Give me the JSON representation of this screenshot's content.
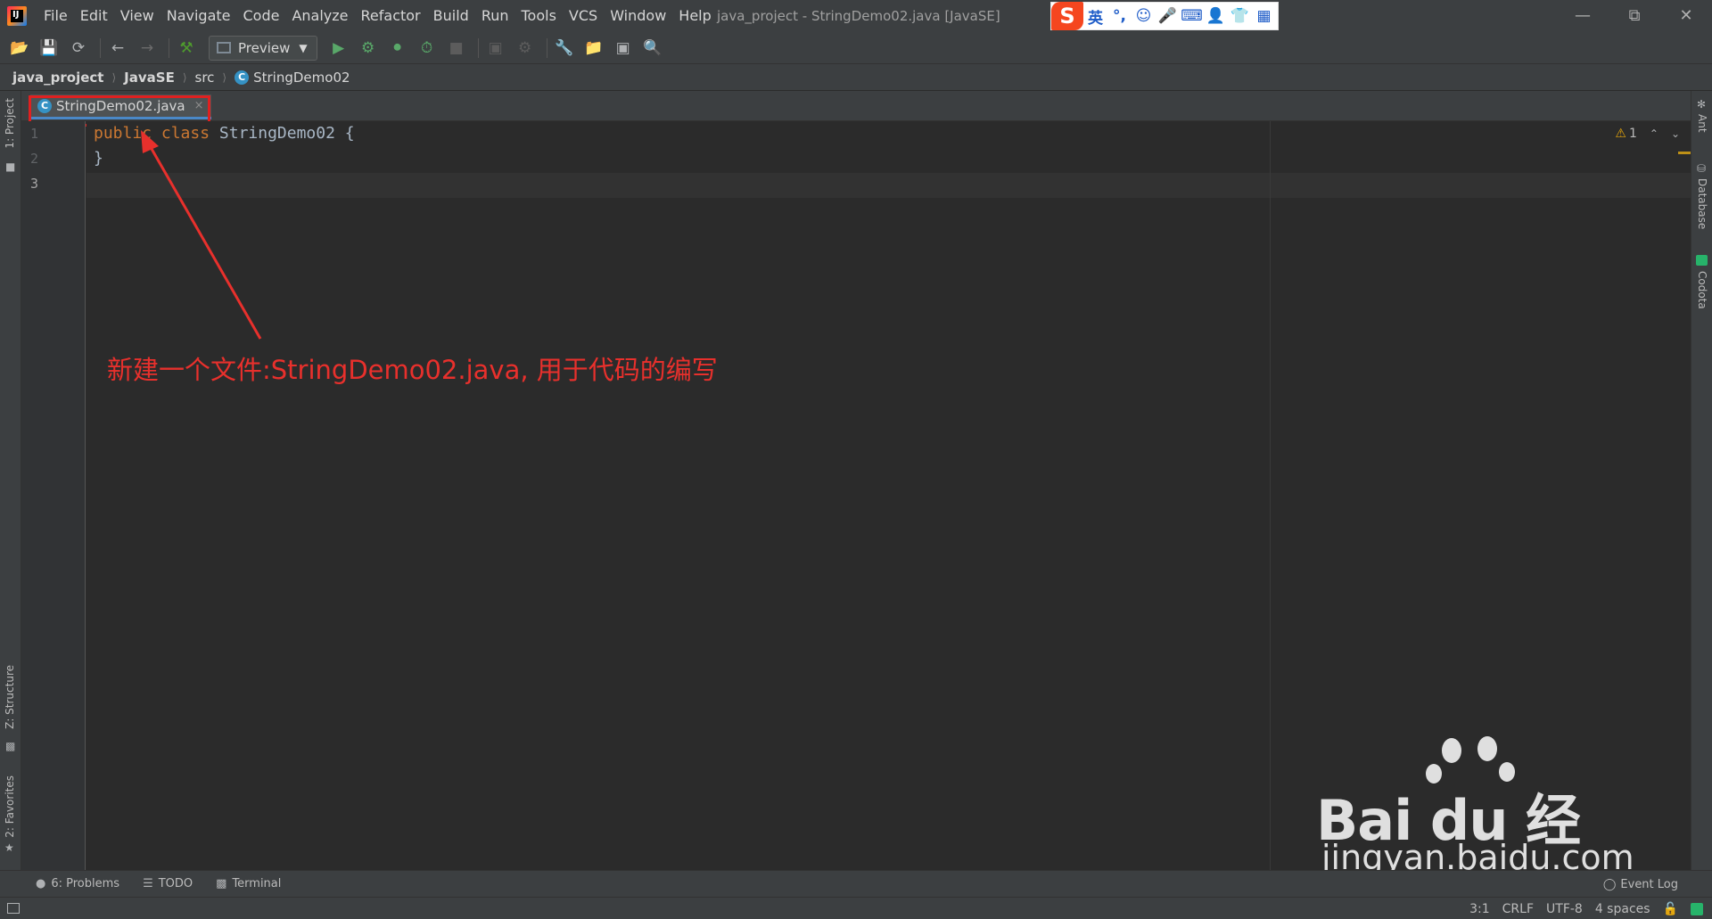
{
  "titlebar": {
    "menu": [
      "File",
      "Edit",
      "View",
      "Navigate",
      "Code",
      "Analyze",
      "Refactor",
      "Build",
      "Run",
      "Tools",
      "VCS",
      "Window",
      "Help"
    ],
    "window_title": "java_project - StringDemo02.java [JavaSE]",
    "ime": {
      "logo": "S",
      "lang": "英",
      "items": [
        "°,",
        "☺",
        "🎤",
        "⌨",
        "👤",
        "👕",
        "▦"
      ]
    }
  },
  "toolbar": {
    "run_config": "Preview"
  },
  "breadcrumb": {
    "items": [
      "java_project",
      "JavaSE",
      "src",
      "StringDemo02"
    ]
  },
  "left_strip": {
    "project": "1: Project",
    "structure": "Z: Structure",
    "favorites": "2: Favorites"
  },
  "right_strip": {
    "ant": "Ant",
    "database": "Database",
    "codota": "Codota"
  },
  "editor_tab": {
    "label": "StringDemo02.java",
    "close": "×"
  },
  "editor": {
    "line_numbers": [
      "1",
      "2",
      "3"
    ],
    "code": {
      "kw1": "public",
      "kw2": "class",
      "name": " StringDemo02 {",
      "line2": "}"
    },
    "inspection": {
      "warnings": "1"
    }
  },
  "annotation": {
    "text": "新建一个文件:StringDemo02.java, 用于代码的编写"
  },
  "watermark": {
    "main": "Bai du 经验",
    "sub": "jingyan.baidu.com"
  },
  "bottom_bar": {
    "problems": "6: Problems",
    "todo": "TODO",
    "terminal": "Terminal",
    "event_log": "Event Log"
  },
  "statusbar": {
    "position": "3:1",
    "line_sep": "CRLF",
    "encoding": "UTF-8",
    "indent": "4 spaces"
  },
  "colors": {
    "annotation_red": "#e02020",
    "keyword": "#cc7832",
    "tab_underline": "#4a88c7"
  }
}
